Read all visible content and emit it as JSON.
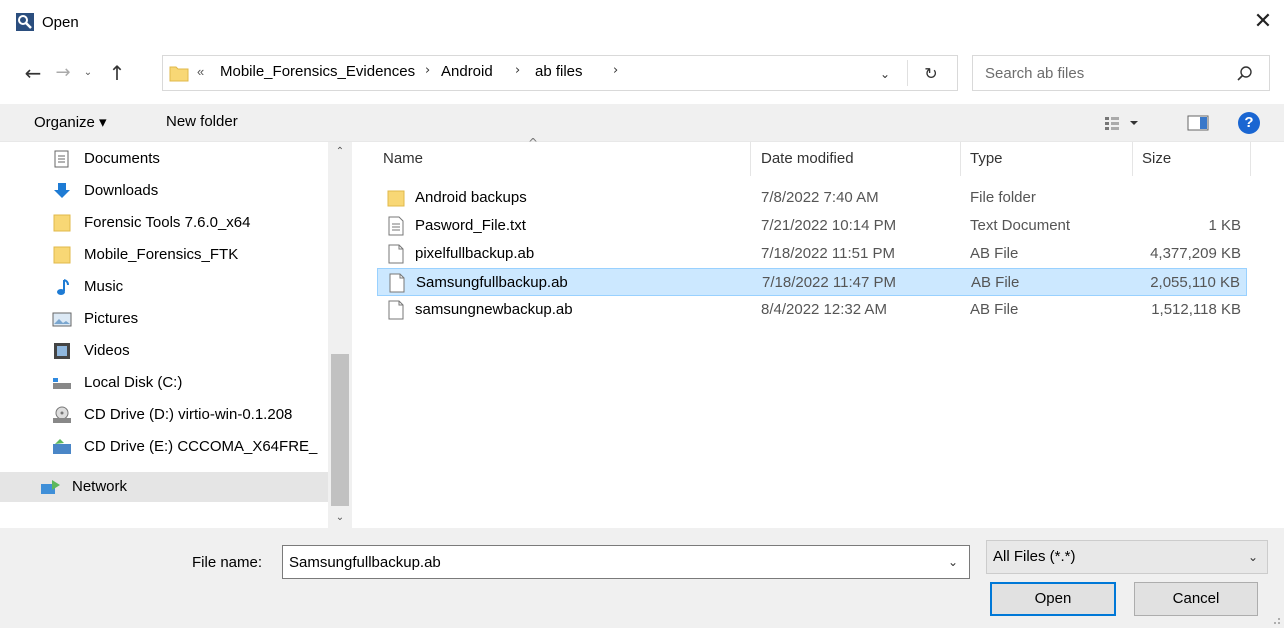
{
  "window": {
    "title": "Open",
    "close_glyph": "✕"
  },
  "nav": {
    "back_glyph": "←",
    "forward_glyph": "→",
    "recent_glyph": "⌄",
    "up_glyph": "↑",
    "address_prefix": "«",
    "breadcrumbs": [
      "Mobile_Forensics_Evidences",
      "Android",
      "ab files"
    ],
    "crumb_sep": "›",
    "dropdown_glyph": "⌄",
    "refresh_glyph": "↻"
  },
  "search": {
    "placeholder": "Search ab files"
  },
  "toolbar": {
    "organize_label": "Organize ▾",
    "new_folder_label": "New folder",
    "help_label": "?"
  },
  "sidebar": {
    "items": [
      {
        "label": "Documents",
        "icon": "documents-icon"
      },
      {
        "label": "Downloads",
        "icon": "downloads-icon"
      },
      {
        "label": "Forensic Tools 7.6.0_x64",
        "icon": "folder-icon"
      },
      {
        "label": "Mobile_Forensics_FTK",
        "icon": "folder-icon"
      },
      {
        "label": "Music",
        "icon": "music-icon"
      },
      {
        "label": "Pictures",
        "icon": "pictures-icon"
      },
      {
        "label": "Videos",
        "icon": "videos-icon"
      },
      {
        "label": "Local Disk (C:)",
        "icon": "local-disk-icon"
      },
      {
        "label": "CD Drive (D:) virtio-win-0.1.208",
        "icon": "cd-drive-icon"
      },
      {
        "label": "CD Drive (E:) CCCOMA_X64FRE_",
        "icon": "cd-drive-icon"
      }
    ],
    "network_label": "Network",
    "scroll_up": "⌃",
    "scroll_down": "⌄"
  },
  "filelist": {
    "sort_glyph": "^",
    "columns": {
      "name": "Name",
      "date": "Date modified",
      "type": "Type",
      "size": "Size"
    },
    "rows": [
      {
        "name": "Android backups",
        "date": "7/8/2022 7:40 AM",
        "type": "File folder",
        "size": "",
        "icon": "folder-icon",
        "selected": false
      },
      {
        "name": "Pasword_File.txt",
        "date": "7/21/2022 10:14 PM",
        "type": "Text Document",
        "size": "1 KB",
        "icon": "text-file-icon",
        "selected": false
      },
      {
        "name": "pixelfullbackup.ab",
        "date": "7/18/2022 11:51 PM",
        "type": "AB File",
        "size": "4,377,209 KB",
        "icon": "file-icon",
        "selected": false
      },
      {
        "name": "Samsungfullbackup.ab",
        "date": "7/18/2022 11:47 PM",
        "type": "AB File",
        "size": "2,055,110 KB",
        "icon": "file-icon",
        "selected": true
      },
      {
        "name": "samsungnewbackup.ab",
        "date": "8/4/2022 12:32 AM",
        "type": "AB File",
        "size": "1,512,118 KB",
        "icon": "file-icon",
        "selected": false
      }
    ]
  },
  "footer": {
    "filename_label": "File name:",
    "filename_value": "Samsungfullbackup.ab",
    "filetype_value": "All Files (*.*)",
    "dropdown_glyph": "⌄",
    "open_label": "Open",
    "cancel_label": "Cancel"
  },
  "colors": {
    "selection": "#cce8ff",
    "selection_border": "#99d1ff",
    "accent": "#0078d7",
    "folder": "#f8d775",
    "help": "#1a66d2"
  }
}
